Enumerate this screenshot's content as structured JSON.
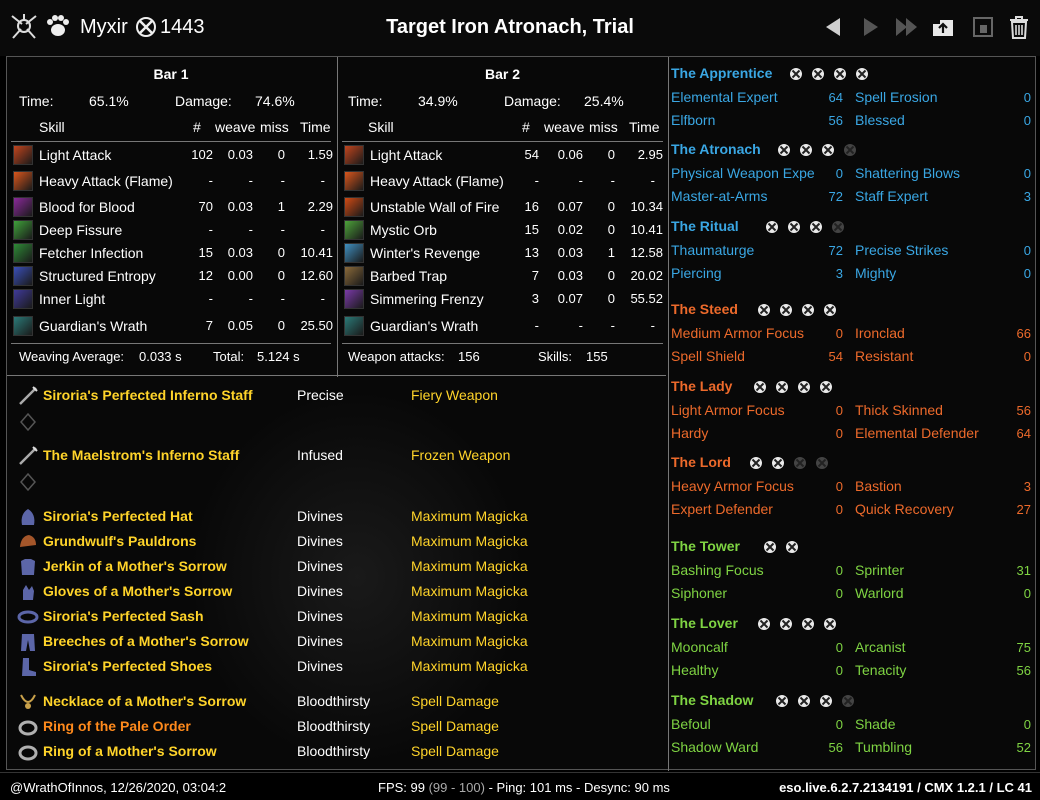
{
  "titlebar": {
    "player_name": "Myxir",
    "cp": "1443",
    "title": "Target Iron Atronach, Trial",
    "icons": [
      "class-icon",
      "race-paw-icon",
      "champion-icon",
      "back-arrow-icon",
      "forward-arrow-icon",
      "fast-forward-icon",
      "upload-icon",
      "save-icon",
      "trash-icon"
    ]
  },
  "bar1": {
    "title": "Bar 1",
    "time_label": "Time:",
    "time": "65.1%",
    "damage_label": "Damage:",
    "damage": "74.6%",
    "headers": {
      "skill": "Skill",
      "count": "#",
      "weave": "weave",
      "miss": "miss",
      "time": "Time"
    },
    "rows": [
      {
        "name": "Light Attack",
        "count": "102",
        "weave": "0.03",
        "miss": "0",
        "time": "1.59",
        "icon": "light-attack-icon",
        "color": "#c2451e"
      },
      {
        "name": "Heavy Attack (Flame)",
        "count": "-",
        "weave": "-",
        "miss": "-",
        "time": "-",
        "icon": "heavy-attack-icon",
        "color": "#d9561c"
      },
      {
        "name": "Blood for Blood",
        "count": "70",
        "weave": "0.03",
        "miss": "1",
        "time": "2.29",
        "icon": "blood-for-blood-icon",
        "color": "#8a2a9a"
      },
      {
        "name": "Deep Fissure",
        "count": "-",
        "weave": "-",
        "miss": "-",
        "time": "-",
        "icon": "deep-fissure-icon",
        "color": "#3fa13a"
      },
      {
        "name": "Fetcher Infection",
        "count": "15",
        "weave": "0.03",
        "miss": "0",
        "time": "10.41",
        "icon": "fetcher-infection-icon",
        "color": "#2e8a36"
      },
      {
        "name": "Structured Entropy",
        "count": "12",
        "weave": "0.00",
        "miss": "0",
        "time": "12.60",
        "icon": "structured-entropy-icon",
        "color": "#3a4fb8"
      },
      {
        "name": "Inner Light",
        "count": "-",
        "weave": "-",
        "miss": "-",
        "time": "-",
        "icon": "inner-light-icon",
        "color": "#3f3a9a"
      },
      {
        "name": "Guardian's Wrath",
        "count": "7",
        "weave": "0.05",
        "miss": "0",
        "time": "25.50",
        "icon": "guardians-wrath-icon",
        "color": "#2b7a78"
      }
    ],
    "footer_left_label": "Weaving Average:",
    "footer_left_value": "0.033 s",
    "footer_right_label": "Total:",
    "footer_right_value": "5.124 s"
  },
  "bar2": {
    "title": "Bar 2",
    "time_label": "Time:",
    "time": "34.9%",
    "damage_label": "Damage:",
    "damage": "25.4%",
    "headers": {
      "skill": "Skill",
      "count": "#",
      "weave": "weave",
      "miss": "miss",
      "time": "Time"
    },
    "rows": [
      {
        "name": "Light Attack",
        "count": "54",
        "weave": "0.06",
        "miss": "0",
        "time": "2.95",
        "icon": "light-attack-icon",
        "color": "#c2451e"
      },
      {
        "name": "Heavy Attack (Flame)",
        "count": "-",
        "weave": "-",
        "miss": "-",
        "time": "-",
        "icon": "heavy-attack-icon",
        "color": "#d9561c"
      },
      {
        "name": "Unstable Wall of Fire",
        "count": "16",
        "weave": "0.07",
        "miss": "0",
        "time": "10.34",
        "icon": "wall-of-fire-icon",
        "color": "#d04a14"
      },
      {
        "name": "Mystic Orb",
        "count": "15",
        "weave": "0.02",
        "miss": "0",
        "time": "10.41",
        "icon": "mystic-orb-icon",
        "color": "#4da23a"
      },
      {
        "name": "Winter's Revenge",
        "count": "13",
        "weave": "0.03",
        "miss": "1",
        "time": "12.58",
        "icon": "winters-revenge-icon",
        "color": "#3f8fc0"
      },
      {
        "name": "Barbed Trap",
        "count": "7",
        "weave": "0.03",
        "miss": "0",
        "time": "20.02",
        "icon": "barbed-trap-icon",
        "color": "#8a6a3a"
      },
      {
        "name": "Simmering Frenzy",
        "count": "3",
        "weave": "0.07",
        "miss": "0",
        "time": "55.52",
        "icon": "simmering-frenzy-icon",
        "color": "#7a3aa8"
      },
      {
        "name": "Guardian's Wrath",
        "count": "-",
        "weave": "-",
        "miss": "-",
        "time": "-",
        "icon": "guardians-wrath-icon",
        "color": "#2b7a78"
      }
    ],
    "footer_left_label": "Weapon attacks:",
    "footer_left_value": "156",
    "footer_right_label": "Skills:",
    "footer_right_value": "155"
  },
  "gear": [
    {
      "name": "Siroria's Perfected Inferno Staff",
      "trait": "Precise",
      "enchant": "Fiery Weapon",
      "icon": "staff-icon",
      "quality": "gold"
    },
    {
      "name": "The Maelstrom's Inferno Staff",
      "trait": "Infused",
      "enchant": "Frozen Weapon",
      "icon": "staff-icon",
      "quality": "gold"
    },
    {
      "name": "Siroria's Perfected Hat",
      "trait": "Divines",
      "enchant": "Maximum Magicka",
      "icon": "hat-icon",
      "quality": "gold"
    },
    {
      "name": "Grundwulf's Pauldrons",
      "trait": "Divines",
      "enchant": "Maximum Magicka",
      "icon": "pauldrons-icon",
      "quality": "gold"
    },
    {
      "name": "Jerkin of a Mother's Sorrow",
      "trait": "Divines",
      "enchant": "Maximum Magicka",
      "icon": "jerkin-icon",
      "quality": "gold"
    },
    {
      "name": "Gloves of a Mother's Sorrow",
      "trait": "Divines",
      "enchant": "Maximum Magicka",
      "icon": "gloves-icon",
      "quality": "gold"
    },
    {
      "name": "Siroria's Perfected Sash",
      "trait": "Divines",
      "enchant": "Maximum Magicka",
      "icon": "sash-icon",
      "quality": "gold"
    },
    {
      "name": "Breeches of a Mother's Sorrow",
      "trait": "Divines",
      "enchant": "Maximum Magicka",
      "icon": "breeches-icon",
      "quality": "gold"
    },
    {
      "name": "Siroria's Perfected Shoes",
      "trait": "Divines",
      "enchant": "Maximum Magicka",
      "icon": "shoes-icon",
      "quality": "gold"
    },
    {
      "name": "Necklace of a Mother's Sorrow",
      "trait": "Bloodthirsty",
      "enchant": "Spell Damage",
      "icon": "necklace-icon",
      "quality": "gold"
    },
    {
      "name": "Ring of the Pale Order",
      "trait": "Bloodthirsty",
      "enchant": "Spell Damage",
      "icon": "ring-icon",
      "quality": "orange"
    },
    {
      "name": "Ring of a Mother's Sorrow",
      "trait": "Bloodthirsty",
      "enchant": "Spell Damage",
      "icon": "ring-icon",
      "quality": "gold"
    }
  ],
  "cp": [
    {
      "title": "The Apprentice",
      "color": "blue",
      "dots": 4,
      "active": 4,
      "stars": [
        [
          "Elemental Expert",
          "64"
        ],
        [
          "Spell Erosion",
          "0"
        ],
        [
          "Elfborn",
          "56"
        ],
        [
          "Blessed",
          "0"
        ]
      ]
    },
    {
      "title": "The Atronach",
      "color": "blue",
      "dots": 4,
      "active": 3,
      "stars": [
        [
          "Physical Weapon Expe",
          "0"
        ],
        [
          "Shattering Blows",
          "0"
        ],
        [
          "Master-at-Arms",
          "72"
        ],
        [
          "Staff Expert",
          "3"
        ]
      ]
    },
    {
      "title": "The Ritual",
      "color": "blue",
      "dots": 4,
      "active": 3,
      "stars": [
        [
          "Thaumaturge",
          "72"
        ],
        [
          "Precise Strikes",
          "0"
        ],
        [
          "Piercing",
          "3"
        ],
        [
          "Mighty",
          "0"
        ]
      ]
    },
    {
      "title": "The Steed",
      "color": "red",
      "dots": 4,
      "active": 4,
      "stars": [
        [
          "Medium Armor Focus",
          "0"
        ],
        [
          "Ironclad",
          "66"
        ],
        [
          "Spell Shield",
          "54"
        ],
        [
          "Resistant",
          "0"
        ]
      ]
    },
    {
      "title": "The Lady",
      "color": "red",
      "dots": 4,
      "active": 4,
      "stars": [
        [
          "Light Armor Focus",
          "0"
        ],
        [
          "Thick Skinned",
          "56"
        ],
        [
          "Hardy",
          "0"
        ],
        [
          "Elemental Defender",
          "64"
        ]
      ]
    },
    {
      "title": "The Lord",
      "color": "red",
      "dots": 4,
      "active": 2,
      "stars": [
        [
          "Heavy Armor Focus",
          "0"
        ],
        [
          "Bastion",
          "3"
        ],
        [
          "Expert Defender",
          "0"
        ],
        [
          "Quick Recovery",
          "27"
        ]
      ]
    },
    {
      "title": "The Tower",
      "color": "green",
      "dots": 2,
      "active": 2,
      "stars": [
        [
          "Bashing Focus",
          "0"
        ],
        [
          "Sprinter",
          "31"
        ],
        [
          "Siphoner",
          "0"
        ],
        [
          "Warlord",
          "0"
        ]
      ]
    },
    {
      "title": "The Lover",
      "color": "green",
      "dots": 4,
      "active": 4,
      "stars": [
        [
          "Mooncalf",
          "0"
        ],
        [
          "Arcanist",
          "75"
        ],
        [
          "Healthy",
          "0"
        ],
        [
          "Tenacity",
          "56"
        ]
      ]
    },
    {
      "title": "The Shadow",
      "color": "green",
      "dots": 4,
      "active": 3,
      "stars": [
        [
          "Befoul",
          "0"
        ],
        [
          "Shade",
          "0"
        ],
        [
          "Shadow Ward",
          "56"
        ],
        [
          "Tumbling",
          "52"
        ]
      ]
    }
  ],
  "statusbar": {
    "left": "@WrathOfInnos, 12/26/2020, 03:04:2",
    "fps_label": "FPS: 99",
    "fps_range": "(99 - 100)",
    "ping": "- Ping: 101 ms - Desync: 90 ms",
    "right": "eso.live.6.2.7.2134191 / CMX 1.2.1 / LC 41"
  },
  "colors": {
    "gold": "#ffd42a",
    "orange": "#ff8a1c",
    "blue": "#3aa7e4",
    "red": "#ed6a2b",
    "green": "#7fd443"
  }
}
